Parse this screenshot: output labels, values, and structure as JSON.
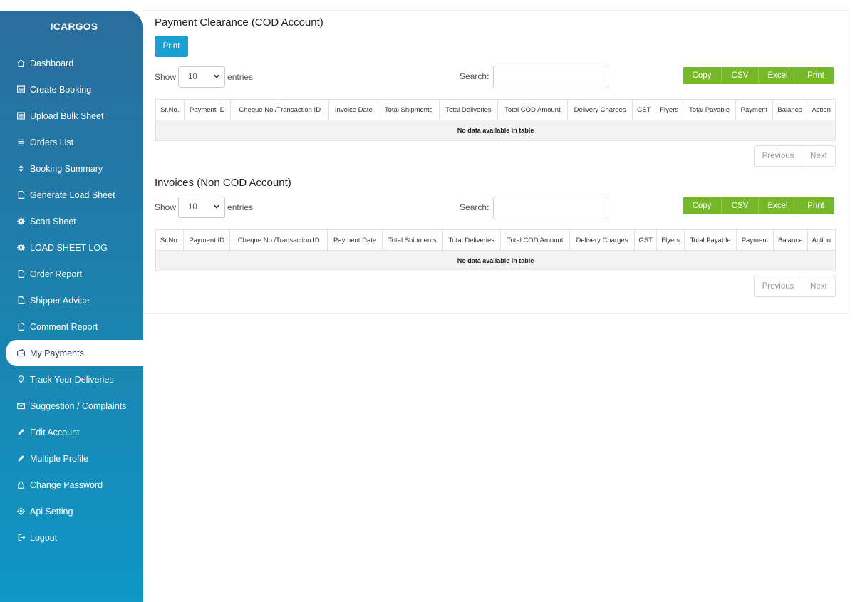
{
  "sidebar": {
    "brand": "ICARGOS",
    "items": [
      {
        "label": "Dashboard",
        "icon": "home-icon"
      },
      {
        "label": "Create Booking",
        "icon": "list-alt-icon"
      },
      {
        "label": "Upload Bulk Sheet",
        "icon": "list-alt-icon"
      },
      {
        "label": "Orders List",
        "icon": "list-icon"
      },
      {
        "label": "Booking Summary",
        "icon": "sort-icon"
      },
      {
        "label": "Generate Load Sheet",
        "icon": "file-icon"
      },
      {
        "label": "Scan Sheet",
        "icon": "gear-icon"
      },
      {
        "label": "LOAD SHEET LOG",
        "icon": "gear-icon"
      },
      {
        "label": "Order Report",
        "icon": "file-icon"
      },
      {
        "label": "Shipper Advice",
        "icon": "file-icon"
      },
      {
        "label": "Comment Report",
        "icon": "file-icon"
      },
      {
        "label": "My Payments",
        "icon": "wallet-icon"
      },
      {
        "label": "Track Your Deliveries",
        "icon": "map-pin-icon"
      },
      {
        "label": "Suggestion / Complaints",
        "icon": "envelope-icon"
      },
      {
        "label": "Edit Account",
        "icon": "pencil-icon"
      },
      {
        "label": "Multiple Profile",
        "icon": "pencil-icon"
      },
      {
        "label": "Change Password",
        "icon": "lock-icon"
      },
      {
        "label": "Api Setting",
        "icon": "cog-outline-icon"
      },
      {
        "label": "Logout",
        "icon": "logout-icon"
      }
    ]
  },
  "cod": {
    "title": "Payment Clearance (COD Account)",
    "print_label": "Print",
    "show_label": "Show",
    "entries_value": "10",
    "entries_label": "entries",
    "search_label": "Search:",
    "search_value": "",
    "buttons": {
      "copy": "Copy",
      "csv": "CSV",
      "excel": "Excel",
      "print": "Print"
    },
    "columns": [
      "Sr.No.",
      "Payment ID",
      "Cheque No./Transaction ID",
      "Invoice Date",
      "Total Shipments",
      "Total Deliveries",
      "Total COD Amount",
      "Delivery Charges",
      "GST",
      "Flyers",
      "Total Payable",
      "Payment",
      "Balance",
      "Action"
    ],
    "empty_text": "No data available in table",
    "prev_label": "Previous",
    "next_label": "Next"
  },
  "invoices": {
    "title": "Invoices (Non COD Account)",
    "show_label": "Show",
    "entries_value": "10",
    "entries_label": "entries",
    "search_label": "Search:",
    "search_value": "",
    "buttons": {
      "copy": "Copy",
      "csv": "CSV",
      "excel": "Excel",
      "print": "Print"
    },
    "columns": [
      "Sr.No.",
      "Payment ID",
      "Cheque No./Transaction ID",
      "Payment Date",
      "Total Shipments",
      "Total Deliveries",
      "Total COD Amount",
      "Delivery Charges",
      "GST",
      "Flyers",
      "Total Payable",
      "Payment",
      "Balance",
      "Action"
    ],
    "empty_text": "No data available in table",
    "prev_label": "Previous",
    "next_label": "Next"
  },
  "colors": {
    "sidebar_top": "#2a6d9c",
    "sidebar_bottom": "#0f97c6",
    "print_blue": "#18a2d4",
    "export_green": "#76b82a"
  }
}
